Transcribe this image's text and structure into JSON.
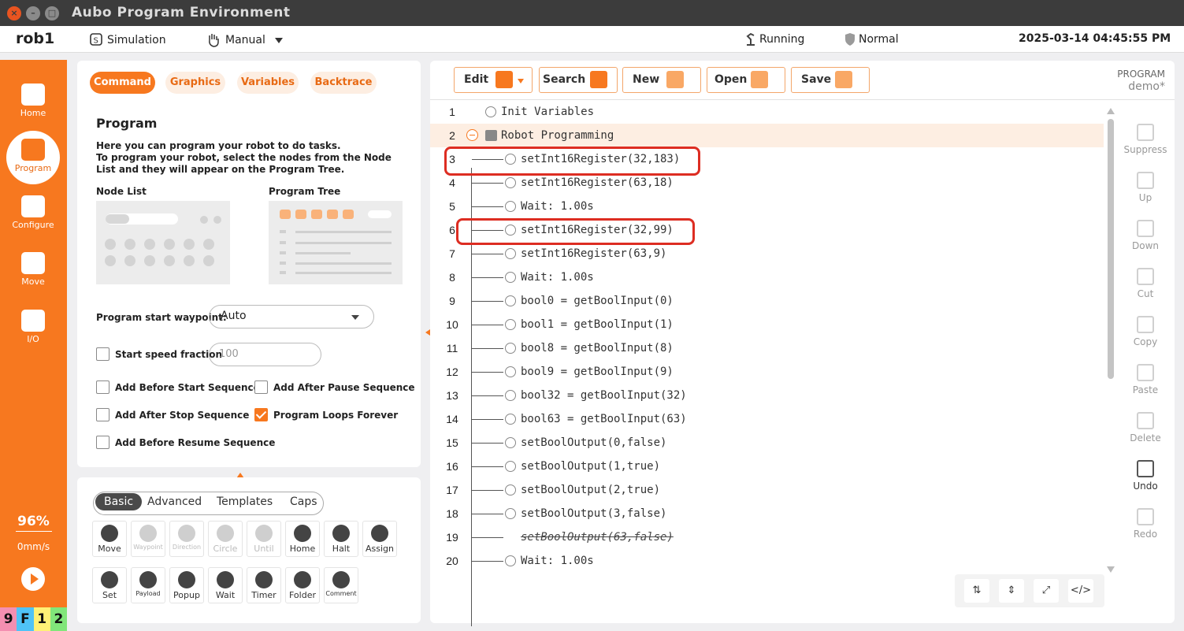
{
  "window": {
    "title": "Aubo Program Environment"
  },
  "statusbar": {
    "robot": "rob1",
    "mode": "Simulation",
    "control": "Manual",
    "state": "Running",
    "safety": "Normal",
    "datetime": "2025-03-14 04:45:55 PM"
  },
  "sidebar": {
    "items": [
      {
        "label": "Home",
        "icon": "home-icon"
      },
      {
        "label": "Program",
        "icon": "code-icon"
      },
      {
        "label": "Configure",
        "icon": "download-icon"
      },
      {
        "label": "Move",
        "icon": "move-icon"
      },
      {
        "label": "I/O",
        "icon": "io-icon"
      }
    ],
    "speed_percent": "96%",
    "speed_value": "0mm/s",
    "keys": [
      "9",
      "F",
      "1",
      "2"
    ]
  },
  "left_panel": {
    "tabs": [
      "Command",
      "Graphics",
      "Variables",
      "Backtrace"
    ],
    "heading": "Program",
    "description_1": "Here you can program your robot to do tasks.",
    "description_2": "To program your robot, select the nodes from the Node List and they will appear on the Program Tree.",
    "node_list_label": "Node List",
    "program_tree_label": "Program Tree",
    "start_waypoint_label": "Program start waypoint:",
    "start_waypoint_value": "Auto",
    "start_speed_label": "Start speed fraction",
    "start_speed_placeholder": "100",
    "checkboxes": [
      {
        "label": "Add Before Start Sequence",
        "checked": false
      },
      {
        "label": "Add After Pause Sequence",
        "checked": false
      },
      {
        "label": "Add After Stop Sequence",
        "checked": false
      },
      {
        "label": "Program Loops Forever",
        "checked": true
      },
      {
        "label": "Add Before Resume Sequence",
        "checked": false
      }
    ]
  },
  "node_panel": {
    "tabs": [
      "Basic",
      "Advanced",
      "Templates",
      "Caps"
    ],
    "nodes_row1": [
      {
        "label": "Move",
        "enabled": true
      },
      {
        "label": "Waypoint",
        "enabled": false
      },
      {
        "label": "Direction",
        "enabled": false
      },
      {
        "label": "Circle",
        "enabled": false
      },
      {
        "label": "Until",
        "enabled": false
      },
      {
        "label": "Home",
        "enabled": true
      },
      {
        "label": "Halt",
        "enabled": true
      },
      {
        "label": "Assign",
        "enabled": true
      }
    ],
    "nodes_row2": [
      {
        "label": "Set",
        "enabled": true
      },
      {
        "label": "Payload",
        "enabled": true
      },
      {
        "label": "Popup",
        "enabled": true
      },
      {
        "label": "Wait",
        "enabled": true
      },
      {
        "label": "Timer",
        "enabled": true
      },
      {
        "label": "Folder",
        "enabled": true
      },
      {
        "label": "Comment",
        "enabled": true
      }
    ]
  },
  "toolbar": {
    "edit": "Edit",
    "search": "Search",
    "new": "New",
    "open": "Open",
    "save": "Save",
    "program_label": "PROGRAM",
    "program_name": "demo*"
  },
  "program_tree": [
    {
      "n": "1",
      "text": "Init Variables"
    },
    {
      "n": "2",
      "text": "Robot Programming"
    },
    {
      "n": "3",
      "text": "setInt16Register(32,183)"
    },
    {
      "n": "4",
      "text": "setInt16Register(63,18)"
    },
    {
      "n": "5",
      "text": "Wait: 1.00s"
    },
    {
      "n": "6",
      "text": "setInt16Register(32,99)"
    },
    {
      "n": "7",
      "text": "setInt16Register(63,9)"
    },
    {
      "n": "8",
      "text": "Wait: 1.00s"
    },
    {
      "n": "9",
      "text": "bool0 = getBoolInput(0)"
    },
    {
      "n": "10",
      "text": "bool1 = getBoolInput(1)"
    },
    {
      "n": "11",
      "text": "bool8 = getBoolInput(8)"
    },
    {
      "n": "12",
      "text": "bool9 = getBoolInput(9)"
    },
    {
      "n": "13",
      "text": "bool32 = getBoolInput(32)"
    },
    {
      "n": "14",
      "text": "bool63 = getBoolInput(63)"
    },
    {
      "n": "15",
      "text": "setBoolOutput(0,false)"
    },
    {
      "n": "16",
      "text": "setBoolOutput(1,true)"
    },
    {
      "n": "17",
      "text": "setBoolOutput(2,true)"
    },
    {
      "n": "18",
      "text": "setBoolOutput(3,false)"
    },
    {
      "n": "19",
      "text": "setBoolOutput(63,false)",
      "suppressed": true
    },
    {
      "n": "20",
      "text": "Wait: 1.00s"
    }
  ],
  "right_tools": [
    "Suppress",
    "Up",
    "Down",
    "Cut",
    "Copy",
    "Paste",
    "Delete",
    "Undo",
    "Redo"
  ],
  "bottom_tools": [
    {
      "icon": "expand-lines-icon",
      "glyph": "⇅"
    },
    {
      "icon": "collapse-lines-icon",
      "glyph": "⇕"
    },
    {
      "icon": "fullscreen-icon",
      "glyph": "⤢"
    },
    {
      "icon": "code-view-icon",
      "glyph": "</>"
    }
  ],
  "colors": {
    "accent": "#f7781f",
    "highlight": "#dd2d22"
  }
}
